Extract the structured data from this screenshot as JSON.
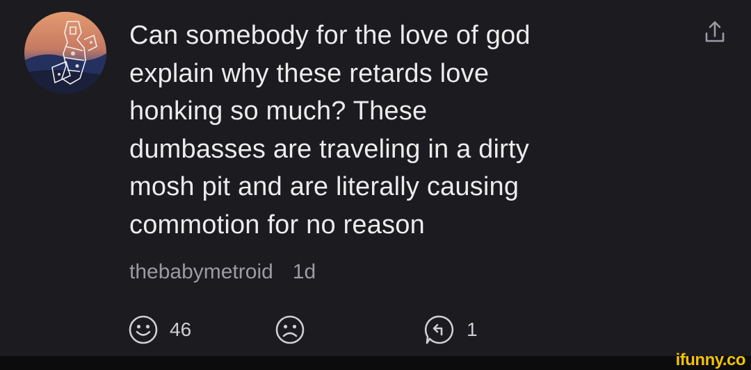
{
  "comment": {
    "text": "Can somebody for the love of god\nexplain why these retards love\nhonking so much? These\ndumbasses are traveling in a dirty\nmosh pit and are literally causing\ncommotion for no reason",
    "username": "thebabymetroid",
    "timestamp": "1d"
  },
  "actions": {
    "smile_count": "46",
    "reply_count": "1"
  },
  "icons": {
    "share": "share-icon",
    "smile": "smile-icon",
    "frown": "frown-icon",
    "reply": "reply-icon"
  },
  "watermark": "ifunny.co",
  "colors": {
    "background": "#1b1b20",
    "text": "#ececec",
    "meta": "#9b9ba3",
    "watermark": "#f5c200"
  }
}
